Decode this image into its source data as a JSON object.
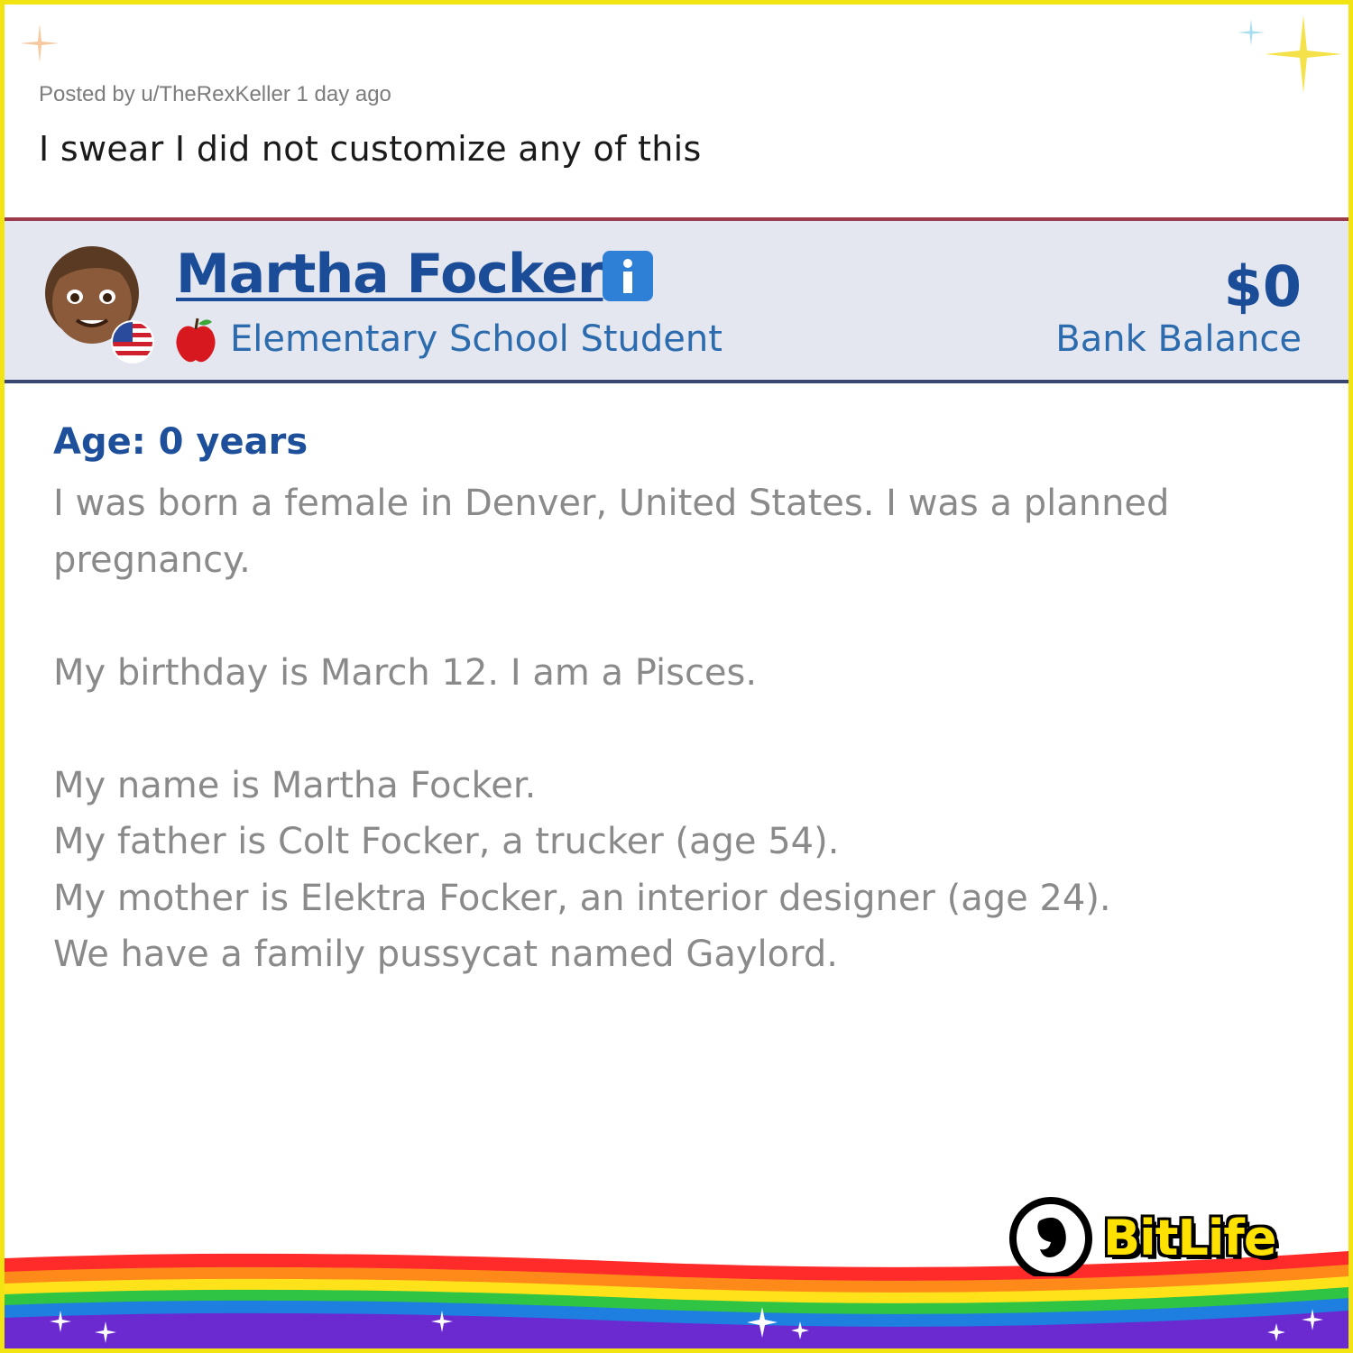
{
  "post": {
    "meta": "Posted by u/TheRexKeller 1 day ago",
    "title": "I swear I did not customize any of this"
  },
  "character": {
    "name": "Martha Focker",
    "occupation": "Elementary School Student",
    "money": "$0",
    "money_label": "Bank Balance",
    "country_flag_icon": "us-flag-icon",
    "occupation_icon": "apple-icon"
  },
  "story": {
    "age_heading": "Age: 0 years",
    "lines": [
      "I was born a female in Denver, United States. I was a planned",
      "pregnancy.",
      "",
      "My birthday is March 12. I am a Pisces.",
      "",
      "My name is Martha Focker.",
      "My father is Colt Focker, a trucker (age 54).",
      "My mother is Elektra Focker, an interior designer (age 24).",
      "We have a family pussycat named Gaylord."
    ]
  },
  "branding": {
    "logo_text": "BitLife"
  },
  "colors": {
    "frame": "#f2e413",
    "header_bg": "#e4e7ef",
    "name_blue": "#1b4c97",
    "sub_blue": "#2c6cae",
    "story_gray": "#8a8a8a"
  }
}
